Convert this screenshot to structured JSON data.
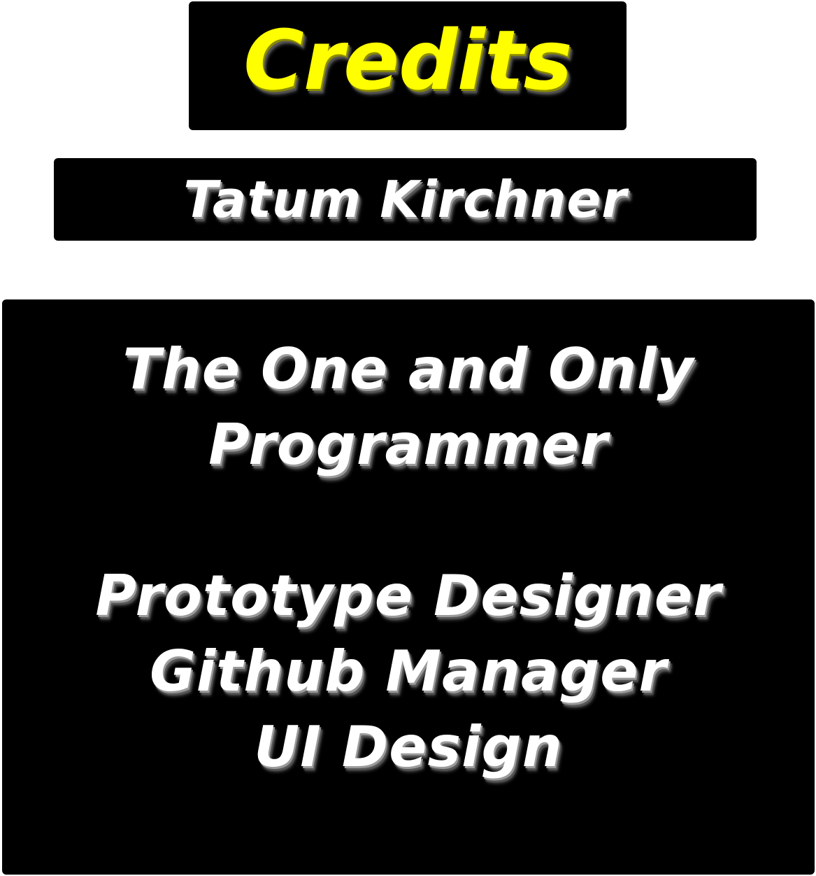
{
  "credits": {
    "title": "Credits",
    "name": "Tatum Kirchner",
    "roles": [
      "The One and Only",
      "Programmer",
      "Prototype Designer",
      "Github Manager",
      "UI Design"
    ]
  },
  "colors": {
    "background": "#ffffff",
    "panel": "#000000",
    "title": "#ffff00",
    "text": "#ffffff"
  }
}
